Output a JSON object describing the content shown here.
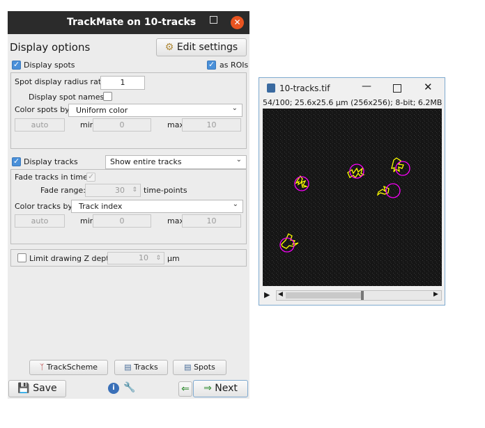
{
  "trackmate": {
    "window_title": "TrackMate on 10-tracks",
    "section_title": "Display options",
    "edit_settings_label": "Edit settings",
    "spots": {
      "display_spots_label": "Display spots",
      "display_spots_checked": true,
      "as_rois_label": "as ROIs",
      "as_rois_checked": true,
      "radius_ratio_label": "Spot display radius ratio:",
      "radius_ratio_value": "1",
      "display_names_label": "Display spot names:",
      "display_names_checked": false,
      "color_by_label": "Color spots by:",
      "color_by_value": "Uniform color",
      "auto_label": "auto",
      "min_label": "min",
      "min_value": "0",
      "max_label": "max",
      "max_value": "10"
    },
    "tracks": {
      "display_tracks_label": "Display tracks",
      "display_tracks_checked": true,
      "mode_value": "Show entire tracks",
      "fade_label": "Fade tracks in time:",
      "fade_checked": true,
      "fade_range_label": "Fade range:",
      "fade_range_value": "30",
      "fade_unit": "time-points",
      "color_by_label": "Color tracks by:",
      "color_by_value": "Track index",
      "auto_label": "auto",
      "min_label": "min",
      "min_value": "0",
      "max_label": "max",
      "max_value": "10"
    },
    "zdepth": {
      "label": "Limit drawing Z depth",
      "checked": false,
      "value": "10",
      "unit": "µm"
    },
    "bottom_buttons": {
      "trackscheme": "TrackScheme",
      "tracks": "Tracks",
      "spots": "Spots"
    },
    "footer": {
      "save": "Save",
      "next": "Next"
    },
    "colors": {
      "titlebar": "#2b2b2b",
      "close": "#e95420",
      "checkbox": "#4a90d9"
    }
  },
  "image_window": {
    "title": "10-tracks.tif",
    "info": "54/100; 25.6x25.6 µm (256x256); 8-bit; 6.2MB",
    "track_color": "#ffff00",
    "spot_color": "#ff00ff"
  }
}
